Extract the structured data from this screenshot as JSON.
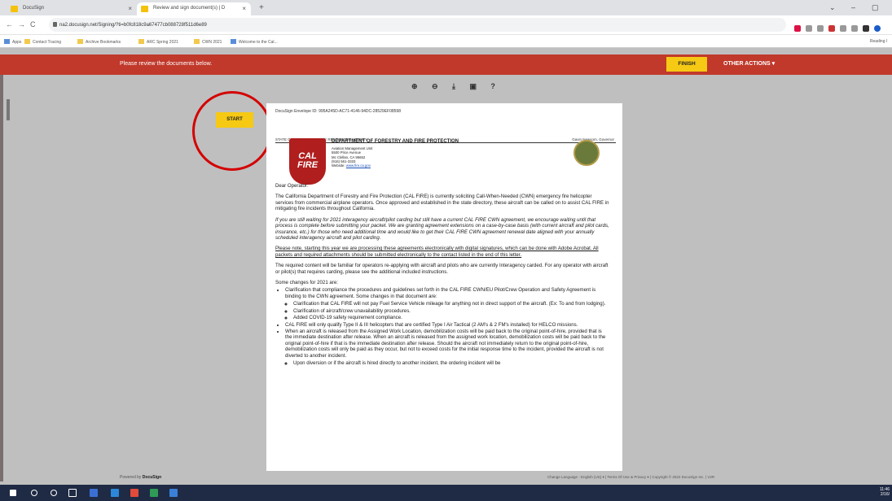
{
  "browser": {
    "tabs": [
      {
        "label": "DocuSign"
      },
      {
        "label": "Review and sign document(s) | D"
      }
    ],
    "new_tab": "+",
    "url": "na2.docusign.net/Signing/?ti=b0fc818c9a67477cb088728f511d6e89",
    "bookmarks": [
      "Apps",
      "Contact Tracing",
      "Archive Bookmarks",
      "ARC Spring 2021",
      "CWN 2021",
      "Welcome to the Cal..."
    ],
    "reading_list": "Reading l"
  },
  "docusign": {
    "banner": "Please review the documents below.",
    "finish_label": "FINISH",
    "other_actions_label": "OTHER ACTIONS ▾",
    "start_label": "START",
    "toolbar_icons": [
      "zoom-in-icon",
      "zoom-out-icon",
      "download-icon",
      "print-icon",
      "help-icon"
    ],
    "powered_by": "Powered by",
    "brand": "DocuSign",
    "footer_right": "Change Language - English (US) ▾  |  Terms Of Use & Privacy ▾  |  Copyright © 2022 DocuSign Inc. | V2R"
  },
  "document": {
    "envelope_id": "DocuSign Envelope ID: 995A245D-AC71-4146-94DC-28529EF08598",
    "header_left": "STATE OF CALIFORNIA—THE RESOURCES AGENCY",
    "header_right": "Gavin Newsom, Governor",
    "logo_text": "CAL FIRE",
    "department": "DEPARTMENT OF FORESTRY AND FIRE PROTECTION",
    "unit": "Aviation Management Unit",
    "street": "5500 Price Avenue",
    "city": "Mc Clellan, CA 95652",
    "phone": "(916) 561-3333",
    "website_label": "Website:",
    "website": "www.fire.ca.gov",
    "salutation": "Dear Operator:",
    "p1": "The California Department of Forestry and Fire Protection (CAL FIRE) is currently soliciting Call-When-Needed (CWN) emergency fire helicopter services from commercial airplane operators. Once approved and established in the state directory, these aircraft can be called on to assist CAL FIRE in mitigating fire incidents throughout California.",
    "p2": "If you are still waiting for 2021 interagency aircraft/pilot carding but still have a current CAL FIRE CWN agreement, we encourage waiting until that process is complete before submitting your packet. We are granting agreement extensions on a case-by-case basis (with current aircraft and pilot cards, insurance, etc.) for those who need additional time and would like to get their CAL FIRE CWN agreement renewal date aligned with your annually scheduled interagency aircraft and pilot carding.",
    "p3": "Please note, starting this year we are processing these agreements electronically with digital signatures, which can be done with Adobe Acrobat. All packets and required attachments should be submitted electronically to the contact listed in the end of this letter.",
    "p4": "The required content will be familiar for operators re-applying with aircraft and pilots who are currently Interagency carded. For any operator with aircraft or pilot(s) that requires carding, please see the additional included instructions.",
    "changes_intro": "Some changes for 2021 are:",
    "bullet1": "Clarification that compliance the procedures and guidelines set forth in the CAL FIRE CWN/EU Pilot/Crew Operation and Safety Agreement is binding to the CWN agreement. Some changes in that document are:",
    "sub1": "Clarification that CAL FIRE will not pay Fuel Service Vehicle mileage for anything not in direct support of the aircraft. (Ex: To and from lodging).",
    "sub2": "Clarification of aircraft/crew unavailability procedures.",
    "sub3": "Added COVID-19 safety requirement compliance.",
    "bullet2": "CAL FIRE will only qualify Type II & III helicopters that are certified Type I Air Tactical (2 AM's & 2 FM's installed) for HELCO missions.",
    "bullet3": "When an aircraft is released from the Assigned Work Location, demobilization costs will be paid back to the original point-of-hire, provided that is the immediate destination after release. When an aircraft is released from the assigned work location, demobilization costs will be paid back to the original point-of-hire if that is the immediate destination after release. Should the aircraft not immediately return to the original point-of-hire, demobilization costs will only be paid as they occur, but not to exceed costs for the initial response time to the incident, provided the aircraft is not diverted to another incident.",
    "sub4": "Upon diversion or if the aircraft is hired directly to another incident, the ordering incident will be"
  },
  "system": {
    "time": "11:46",
    "date": "2/16/"
  },
  "colors": {
    "docusign_red": "#c0392b",
    "action_yellow": "#f6c914",
    "highlight_circle": "#d40000"
  }
}
